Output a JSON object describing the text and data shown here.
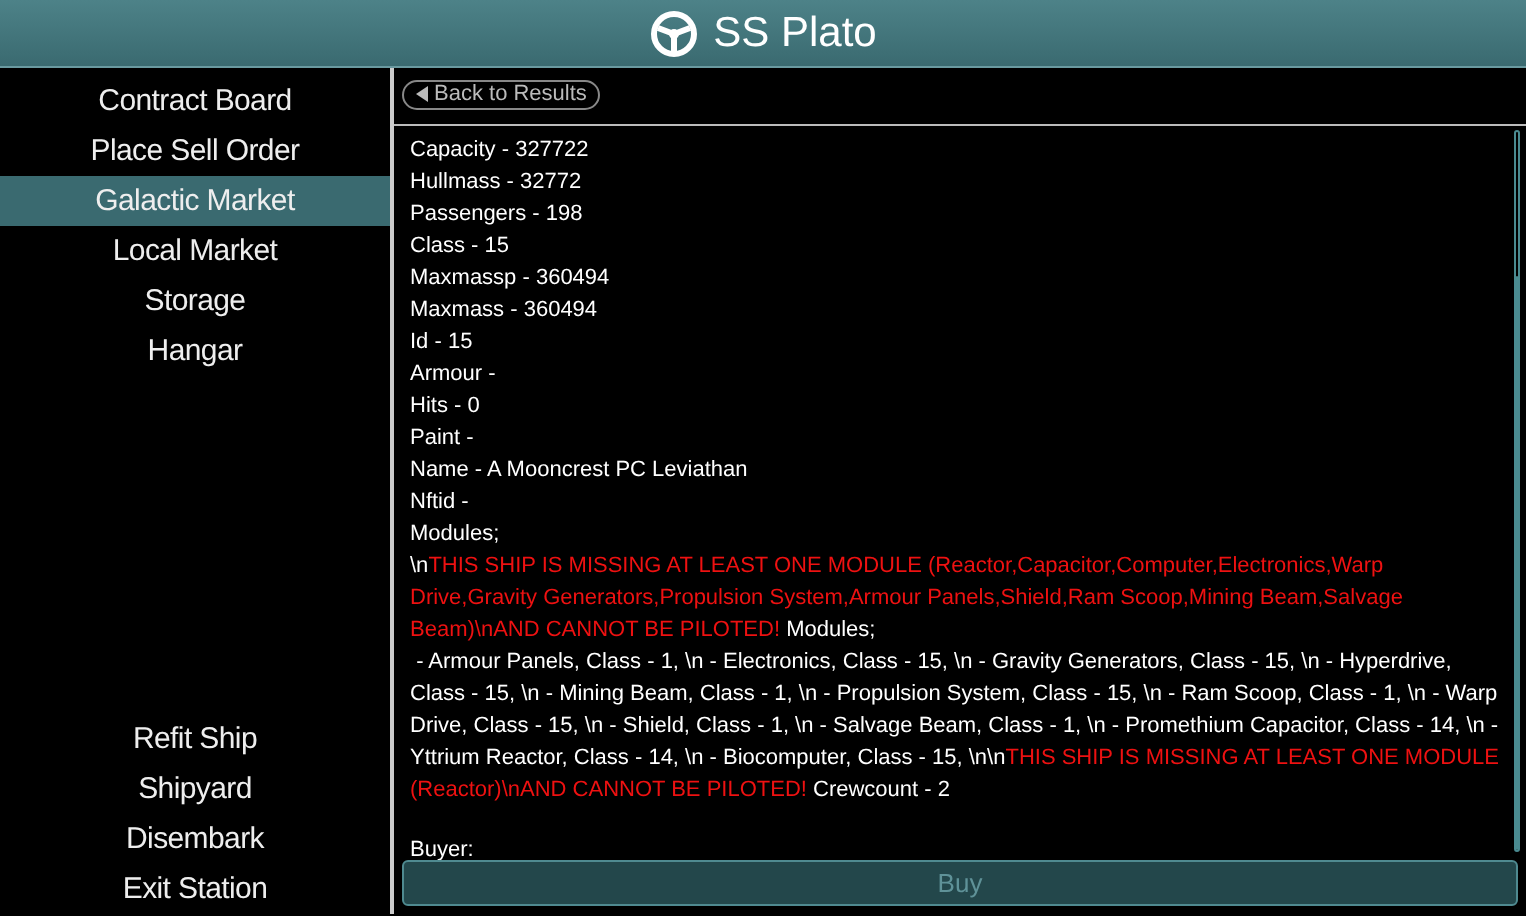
{
  "header": {
    "title": "SS Plato"
  },
  "sidebar": {
    "top_items": [
      {
        "label": "Contract Board",
        "selected": false
      },
      {
        "label": "Place Sell Order",
        "selected": false
      },
      {
        "label": "Galactic Market",
        "selected": true
      },
      {
        "label": "Local Market",
        "selected": false
      },
      {
        "label": "Storage",
        "selected": false
      },
      {
        "label": "Hangar",
        "selected": false
      }
    ],
    "bottom_items": [
      {
        "label": "Refit Ship",
        "selected": false
      },
      {
        "label": "Shipyard",
        "selected": false
      },
      {
        "label": "Disembark",
        "selected": false
      },
      {
        "label": "Exit Station",
        "selected": false
      }
    ]
  },
  "back_button": {
    "label": "Back to Results"
  },
  "details": {
    "lines": [
      "Capacity - 327722",
      "Hullmass - 32772",
      "Passengers - 198",
      "Class - 15",
      "Maxmassp - 360494",
      "Maxmass - 360494",
      "Id - 15",
      "Armour -",
      "Hits - 0",
      "Paint -",
      "Name - A Mooncrest PC Leviathan",
      "Nftid -",
      "Modules;"
    ],
    "paragraph": [
      {
        "kind": "normal",
        "text": "\\n"
      },
      {
        "kind": "warning",
        "text": "THIS SHIP IS MISSING AT LEAST ONE MODULE (Reactor,Capacitor,Computer,Electronics,Warp Drive,Gravity Generators,Propulsion System,Armour Panels,Shield,Ram Scoop,Mining Beam,Salvage Beam)\\nAND CANNOT BE PILOTED!"
      },
      {
        "kind": "normal",
        "text": " Modules;\n - Armour Panels, Class - 1, \\n - Electronics, Class - 15, \\n - Gravity Generators, Class - 15, \\n - Hyperdrive, Class - 15, \\n - Mining Beam, Class - 1, \\n - Propulsion System, Class - 15, \\n - Ram Scoop, Class - 1, \\n - Warp Drive, Class - 15, \\n - Shield, Class - 1, \\n - Salvage Beam, Class - 1, \\n - Promethium Capacitor, Class - 14, \\n - Yttrium Reactor, Class - 14, \\n - Biocomputer, Class - 15, \\n\\n"
      },
      {
        "kind": "warning",
        "text": "THIS SHIP IS MISSING AT LEAST ONE MODULE (Reactor)\\nAND CANNOT BE PILOTED!"
      },
      {
        "kind": "normal",
        "text": " Crewcount - 2"
      }
    ],
    "footer_lines": [
      "Buyer:"
    ]
  },
  "buy_button": {
    "label": "Buy",
    "disabled": true
  }
}
